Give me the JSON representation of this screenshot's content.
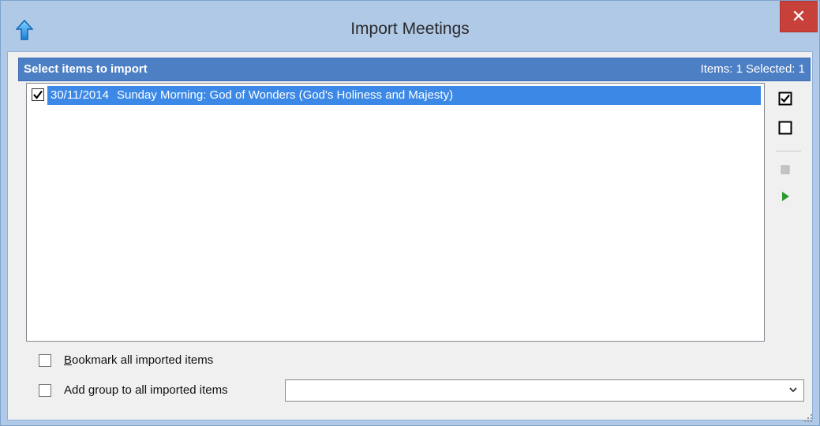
{
  "window": {
    "title": "Import Meetings",
    "close_glyph": "✕",
    "app_icon": "up-arrow-icon"
  },
  "panel": {
    "title": "Select items to import",
    "items_label": "Items: 1",
    "selected_label": "Selected: 1"
  },
  "list": {
    "items": [
      {
        "checked": true,
        "date": "30/11/2014",
        "title": "Sunday Morning: God of Wonders (God's Holiness and Majesty)"
      }
    ]
  },
  "toolbar": {
    "tools": [
      {
        "icon": "check-all-icon"
      },
      {
        "icon": "uncheck-all-icon"
      },
      {
        "icon": "stop-icon"
      },
      {
        "icon": "play-icon"
      }
    ]
  },
  "options": {
    "bookmark_label_accel": "B",
    "bookmark_label_rest": "ookmark all imported items",
    "group_label_pre": "Add ",
    "group_label_accel": "g",
    "group_label_post": "roup to all imported items",
    "group_value": ""
  },
  "colors": {
    "titlebar": "#afc9e6",
    "header": "#4d7fc4",
    "selection": "#3b88e6",
    "close": "#c7403a"
  }
}
